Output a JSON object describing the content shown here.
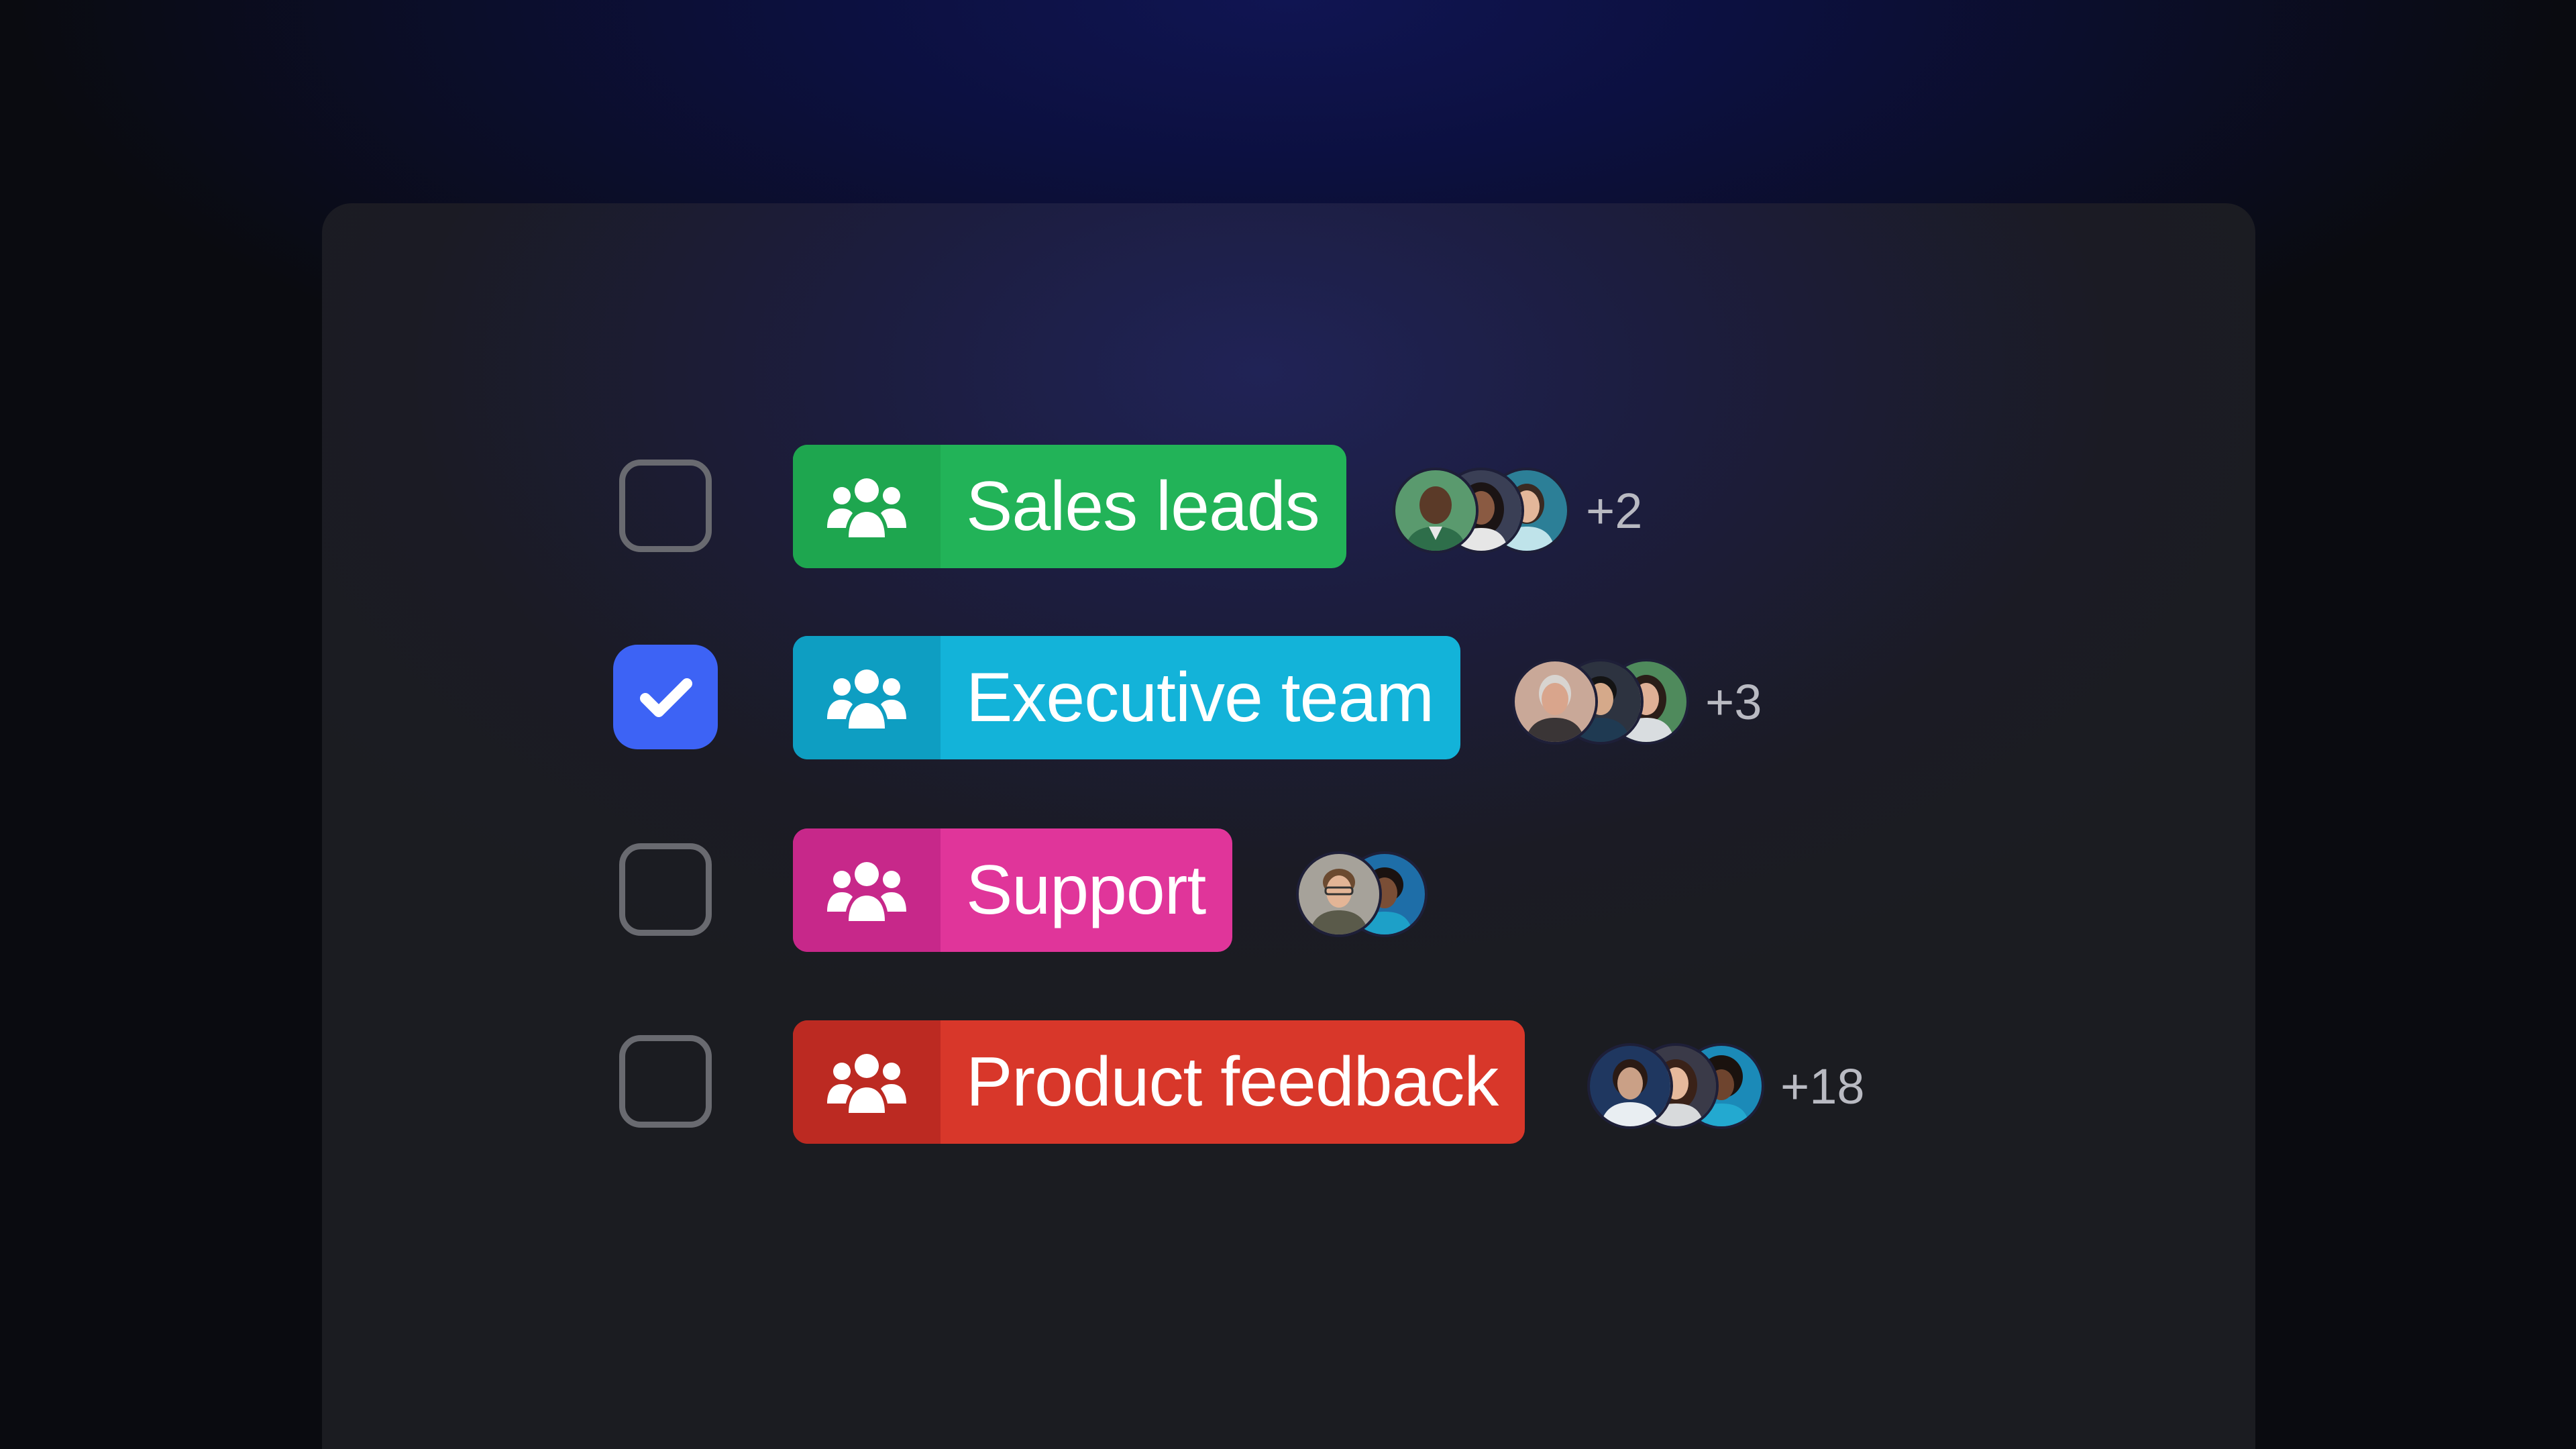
{
  "groups": [
    {
      "label": "Sales leads",
      "checked": false,
      "color": "#22b358",
      "icon_color": "#1ea64f",
      "extra_count": "+2",
      "avatars": [
        "avatar-man-green-bg",
        "avatar-woman-dark-hair",
        "avatar-woman-teal-bg"
      ]
    },
    {
      "label": "Executive team",
      "checked": true,
      "color": "#13b3d9",
      "icon_color": "#0e9ec2",
      "extra_count": "+3",
      "avatars": [
        "avatar-older-man",
        "avatar-man-dark-hair",
        "avatar-woman-green-bg"
      ]
    },
    {
      "label": "Support",
      "checked": false,
      "color": "#e0359a",
      "icon_color": "#c7288a",
      "extra_count": "",
      "avatars": [
        "avatar-man-glasses",
        "avatar-woman-blue-bg"
      ]
    },
    {
      "label": "Product feedback",
      "checked": false,
      "color": "#d8372a",
      "icon_color": "#bc2a22",
      "extra_count": "+18",
      "avatars": [
        "avatar-woman-navy-bg",
        "avatar-woman-brown-hair",
        "avatar-woman-curly-hair"
      ]
    }
  ],
  "icons": {
    "group": "team-icon",
    "check": "check-icon"
  },
  "colors": {
    "checkbox_checked": "#3d63f5",
    "checkbox_border": "#696a70",
    "count_text": "#b9bac2"
  }
}
